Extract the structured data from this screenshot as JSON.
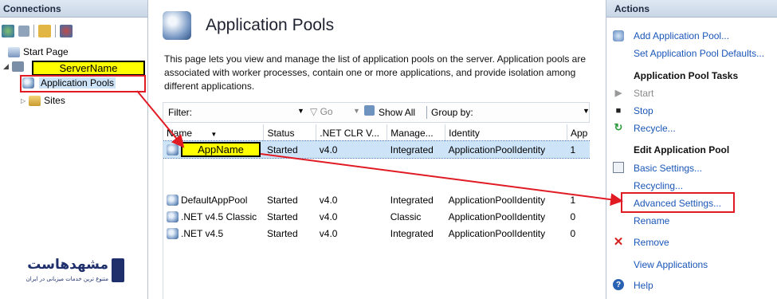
{
  "connections": {
    "header": "Connections",
    "tree": {
      "start_page": "Start Page",
      "server": "ServerName",
      "app_pools": "Application Pools",
      "sites": "Sites"
    }
  },
  "center": {
    "title": "Application Pools",
    "description": "This page lets you view and manage the list of application pools on the server. Application pools are associated with worker processes, contain one or more applications, and provide isolation among different applications.",
    "filter": {
      "label": "Filter:",
      "go": "Go",
      "show_all": "Show All",
      "group_by": "Group by:"
    },
    "columns": [
      "Name",
      "Status",
      ".NET CLR V...",
      "Manage...",
      "Identity",
      "App"
    ],
    "rows": [
      {
        "name": "AppName",
        "status": "Started",
        "clr": "v4.0",
        "pipeline": "Integrated",
        "identity": "ApplicationPoolIdentity",
        "apps": "1"
      },
      {
        "name": "DefaultAppPool",
        "status": "Started",
        "clr": "v4.0",
        "pipeline": "Integrated",
        "identity": "ApplicationPoolIdentity",
        "apps": "1"
      },
      {
        "name": ".NET v4.5 Classic",
        "status": "Started",
        "clr": "v4.0",
        "pipeline": "Classic",
        "identity": "ApplicationPoolIdentity",
        "apps": "0"
      },
      {
        "name": ".NET v4.5",
        "status": "Started",
        "clr": "v4.0",
        "pipeline": "Integrated",
        "identity": "ApplicationPoolIdentity",
        "apps": "0"
      }
    ]
  },
  "actions": {
    "header": "Actions",
    "add_pool": "Add Application Pool...",
    "set_defaults": "Set Application Pool Defaults...",
    "tasks_header": "Application Pool Tasks",
    "start": "Start",
    "stop": "Stop",
    "recycle": "Recycle...",
    "edit_header": "Edit Application Pool",
    "basic_settings": "Basic Settings...",
    "recycling": "Recycling...",
    "advanced_settings": "Advanced Settings...",
    "rename": "Rename",
    "remove": "Remove",
    "view_apps": "View Applications",
    "help": "Help"
  },
  "watermark": {
    "logo_text": "مشهدهاست",
    "tagline": "متنوع ترین خدمات میزبانی در ایران"
  },
  "colors": {
    "link": "#1a56b8",
    "highlight": "#ffff00",
    "annotation_red": "#e01b24",
    "selected_row": "#cde3f8"
  }
}
